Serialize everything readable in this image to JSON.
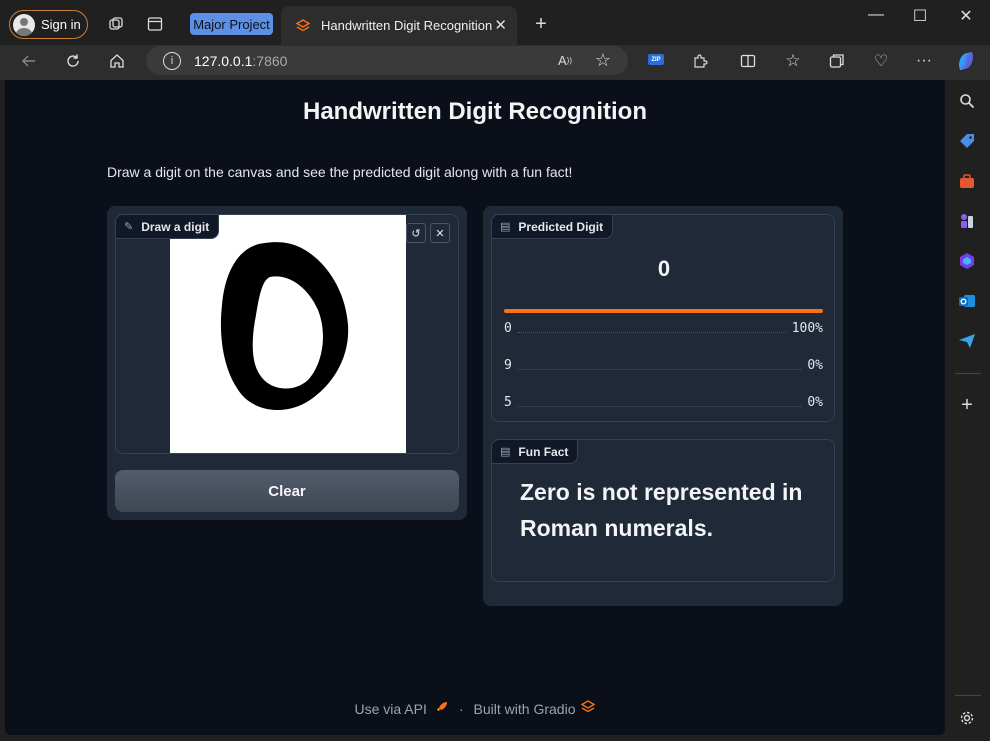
{
  "browser": {
    "signin_label": "Sign in",
    "group_tab_label": "Major Project",
    "tab_title": "Handwritten Digit Recognition",
    "url_host": "127.0.0.1",
    "url_port": ":7860",
    "zip_badge": "ZIP"
  },
  "app": {
    "title": "Handwritten Digit Recognition",
    "description": "Draw a digit on the canvas and see the predicted digit along with a fun fact!",
    "canvas_label": "Draw a digit",
    "clear_label": "Clear",
    "prediction_label": "Predicted Digit",
    "predicted_value": "0",
    "top_confidence": 1.0,
    "confidences": [
      {
        "label": "0",
        "value": "100%"
      },
      {
        "label": "9",
        "value": "0%"
      },
      {
        "label": "5",
        "value": "0%"
      }
    ],
    "fact_label": "Fun Fact",
    "fact_text": "Zero is not represented in Roman numerals."
  },
  "footer": {
    "api_label": "Use via API",
    "separator": "·",
    "built_label": "Built with Gradio"
  },
  "colors": {
    "accent": "#f97316",
    "page_bg": "#0b0f19",
    "panel_bg": "#1f2937"
  }
}
